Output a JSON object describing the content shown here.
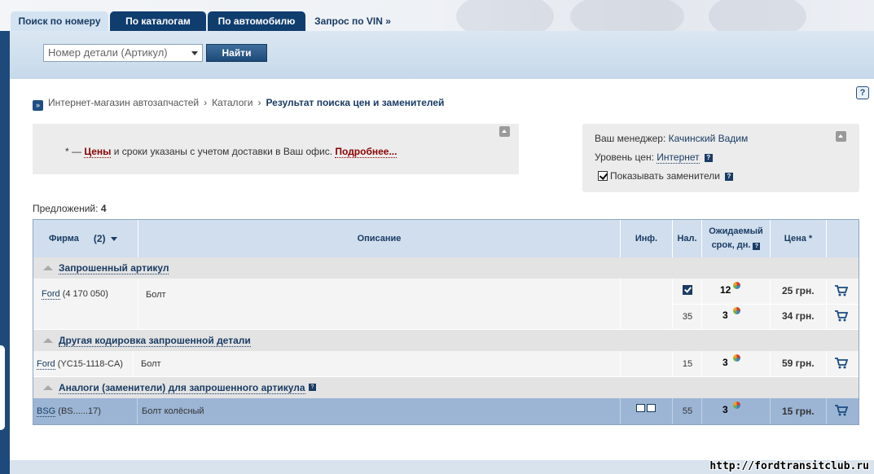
{
  "tabs": [
    {
      "label": "Поиск по номеру",
      "active": true
    },
    {
      "label": "По каталогам",
      "active": false
    },
    {
      "label": "По автомобилю",
      "active": false
    },
    {
      "label": "Запрос по VIN »",
      "active": false
    }
  ],
  "search": {
    "select_value": "Номер детали (Артикул)",
    "find_label": "Найти"
  },
  "help_icon": "?",
  "breadcrumb": {
    "items": [
      "Интернет-магазин автозапчастей",
      "Каталоги"
    ],
    "current": "Результат поиска цен и заменителей",
    "separator": "›"
  },
  "notice": {
    "prefix": "* — ",
    "highlight": "Цены",
    "middle": " и сроки указаны с учетом доставки в Ваш офис. ",
    "link": "Подробнее..."
  },
  "manager": {
    "label": "Ваш менеджер:",
    "name": "Качинский Вадим",
    "price_level_label": "Уровень цен:",
    "price_level": "Интернет",
    "show_replacements_label": "Показывать заменители",
    "show_replacements_checked": true
  },
  "offers": {
    "label": "Предложений:",
    "count": "4"
  },
  "table": {
    "headers": {
      "firm": "Фирма",
      "firm_count": "(2)",
      "description": "Описание",
      "info": "Инф.",
      "stock": "Нал.",
      "expected": "Ожидаемый срок, дн.",
      "price": "Цена *"
    },
    "groups": [
      {
        "title": "Запрошенный артикул"
      },
      {
        "title": "Другая кодировка запрошенной детали"
      },
      {
        "title": "Аналоги (заменители) для запрошенного артикула"
      }
    ],
    "rows": [
      {
        "firm": "Ford",
        "article": "(4 170 050)",
        "description": "Болт",
        "offers": [
          {
            "stock": "",
            "in_stock_icon": true,
            "days": "12",
            "price": "25 грн."
          },
          {
            "stock": "35",
            "in_stock_icon": false,
            "days": "3",
            "price": "34 грн."
          }
        ]
      },
      {
        "firm": "Ford",
        "article": "(YC15-1118-CA)",
        "description": "Болт",
        "offers": [
          {
            "stock": "15",
            "days": "3",
            "price": "59 грн."
          }
        ]
      },
      {
        "firm": "BSG",
        "article": "(BS......17)",
        "description": "Болт колёсный",
        "offers": [
          {
            "stock": "55",
            "days": "3",
            "price": "15 грн."
          }
        ]
      }
    ]
  },
  "footer": {
    "watermark": "http://fordtransitclub.ru"
  }
}
